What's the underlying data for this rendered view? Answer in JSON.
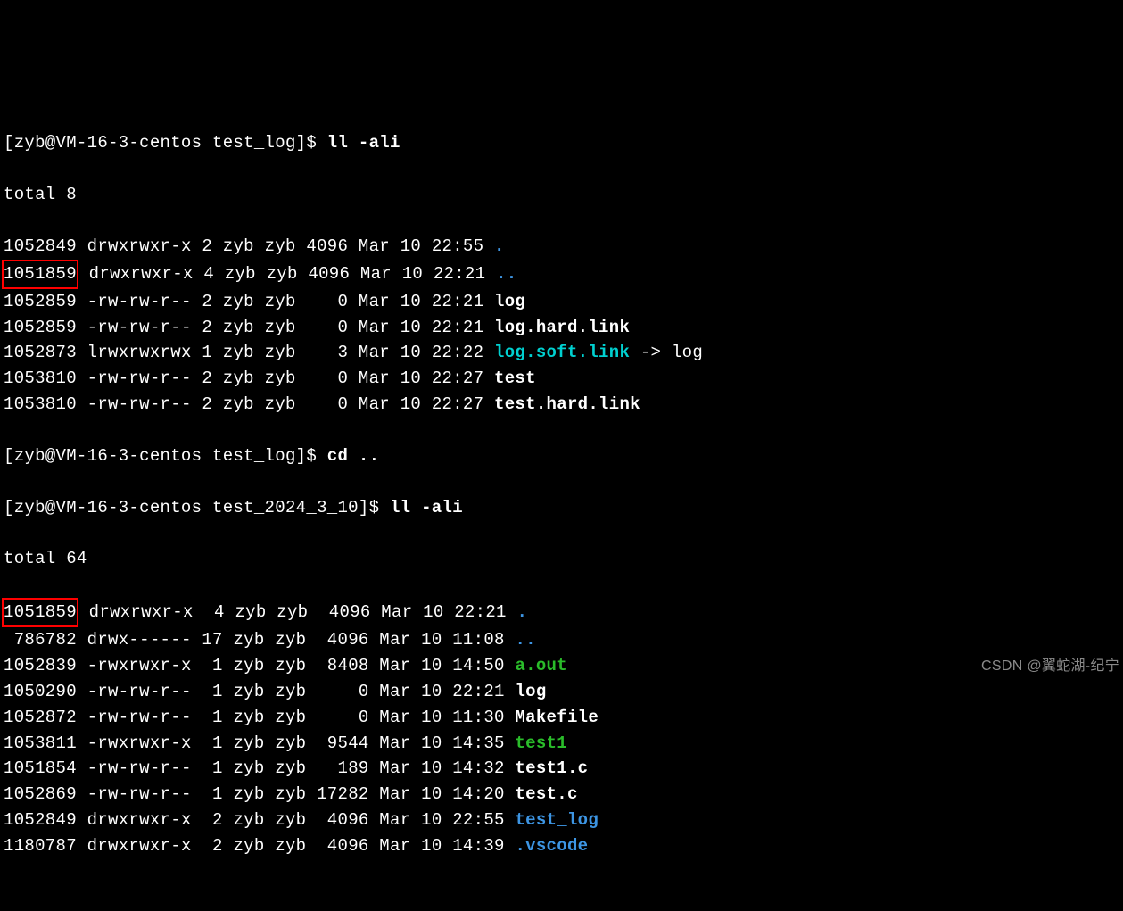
{
  "prompt1": {
    "open": "[",
    "user": "zyb@VM-16-3-centos",
    "dir": " test_log",
    "close": "]$ ",
    "cmd": "ll -ali"
  },
  "total1": "total 8",
  "listing1": [
    {
      "inode": "1052849",
      "perms": " drwxrwxr-x",
      "links": " 2",
      "owner": " zyb",
      "group": " zyb",
      "size": " 4096",
      "date": " Mar 10 22:55 ",
      "name": ".",
      "color": "blue",
      "highlight": false
    },
    {
      "inode": "1051859",
      "perms": " drwxrwxr-x",
      "links": " 4",
      "owner": " zyb",
      "group": " zyb",
      "size": " 4096",
      "date": " Mar 10 22:21 ",
      "name": "..",
      "color": "blue",
      "highlight": true
    },
    {
      "inode": "1052859",
      "perms": " -rw-rw-r--",
      "links": " 2",
      "owner": " zyb",
      "group": " zyb",
      "size": "    0",
      "date": " Mar 10 22:21 ",
      "name": "log",
      "color": "white",
      "highlight": false
    },
    {
      "inode": "1052859",
      "perms": " -rw-rw-r--",
      "links": " 2",
      "owner": " zyb",
      "group": " zyb",
      "size": "    0",
      "date": " Mar 10 22:21 ",
      "name": "log.hard.link",
      "color": "white",
      "highlight": false
    },
    {
      "inode": "1052873",
      "perms": " lrwxrwxrwx",
      "links": " 1",
      "owner": " zyb",
      "group": " zyb",
      "size": "    3",
      "date": " Mar 10 22:22 ",
      "name": "log.soft.link",
      "color": "cyan",
      "arrow": " -> log",
      "highlight": false
    },
    {
      "inode": "1053810",
      "perms": " -rw-rw-r--",
      "links": " 2",
      "owner": " zyb",
      "group": " zyb",
      "size": "    0",
      "date": " Mar 10 22:27 ",
      "name": "test",
      "color": "white",
      "highlight": false
    },
    {
      "inode": "1053810",
      "perms": " -rw-rw-r--",
      "links": " 2",
      "owner": " zyb",
      "group": " zyb",
      "size": "    0",
      "date": " Mar 10 22:27 ",
      "name": "test.hard.link",
      "color": "white",
      "highlight": false
    }
  ],
  "prompt2": {
    "open": "[",
    "user": "zyb@VM-16-3-centos",
    "dir": " test_log",
    "close": "]$ ",
    "cmd": "cd .."
  },
  "prompt3": {
    "open": "[",
    "user": "zyb@VM-16-3-centos",
    "dir": " test_2024_3_10",
    "close": "]$ ",
    "cmd": "ll -ali"
  },
  "total2": "total 64",
  "listing2": [
    {
      "inode": "1051859",
      "perms": " drwxrwxr-x ",
      "links": " 4",
      "owner": " zyb",
      "group": " zyb ",
      "size": " 4096",
      "date": " Mar 10 22:21 ",
      "name": ".",
      "color": "blue",
      "highlight": true
    },
    {
      "inode": " 786782",
      "perms": " drwx------ ",
      "links": "17",
      "owner": " zyb",
      "group": " zyb ",
      "size": " 4096",
      "date": " Mar 10 11:08 ",
      "name": "..",
      "color": "blue",
      "highlight": false
    },
    {
      "inode": "1052839",
      "perms": " -rwxrwxr-x ",
      "links": " 1",
      "owner": " zyb",
      "group": " zyb ",
      "size": " 8408",
      "date": " Mar 10 14:50 ",
      "name": "a.out",
      "color": "green",
      "highlight": false
    },
    {
      "inode": "1050290",
      "perms": " -rw-rw-r-- ",
      "links": " 1",
      "owner": " zyb",
      "group": " zyb ",
      "size": "    0",
      "date": " Mar 10 22:21 ",
      "name": "log",
      "color": "white",
      "highlight": false
    },
    {
      "inode": "1052872",
      "perms": " -rw-rw-r-- ",
      "links": " 1",
      "owner": " zyb",
      "group": " zyb ",
      "size": "    0",
      "date": " Mar 10 11:30 ",
      "name": "Makefile",
      "color": "white",
      "highlight": false
    },
    {
      "inode": "1053811",
      "perms": " -rwxrwxr-x ",
      "links": " 1",
      "owner": " zyb",
      "group": " zyb ",
      "size": " 9544",
      "date": " Mar 10 14:35 ",
      "name": "test1",
      "color": "green",
      "highlight": false
    },
    {
      "inode": "1051854",
      "perms": " -rw-rw-r-- ",
      "links": " 1",
      "owner": " zyb",
      "group": " zyb ",
      "size": "  189",
      "date": " Mar 10 14:32 ",
      "name": "test1.c",
      "color": "white",
      "highlight": false
    },
    {
      "inode": "1052869",
      "perms": " -rw-rw-r-- ",
      "links": " 1",
      "owner": " zyb",
      "group": " zyb ",
      "size": "17282",
      "date": " Mar 10 14:20 ",
      "name": "test.c",
      "color": "white",
      "highlight": false
    },
    {
      "inode": "1052849",
      "perms": " drwxrwxr-x ",
      "links": " 2",
      "owner": " zyb",
      "group": " zyb ",
      "size": " 4096",
      "date": " Mar 10 22:55 ",
      "name": "test_log",
      "color": "blue",
      "highlight": false
    },
    {
      "inode": "1180787",
      "perms": " drwxrwxr-x ",
      "links": " 2",
      "owner": " zyb",
      "group": " zyb ",
      "size": " 4096",
      "date": " Mar 10 14:39 ",
      "name": ".vscode",
      "color": "blue",
      "highlight": false
    }
  ],
  "watermark": "CSDN @翼蛇湖-纪宁"
}
